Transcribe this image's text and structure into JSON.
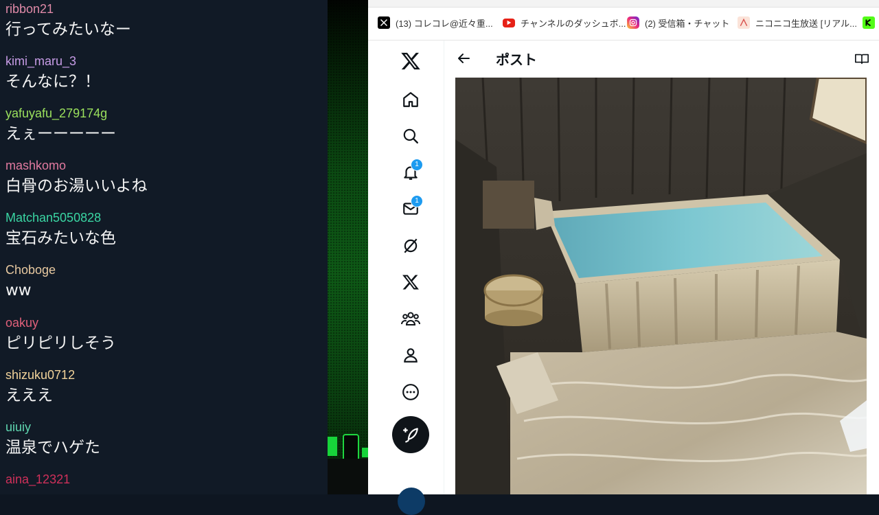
{
  "chat": {
    "messages": [
      {
        "user": "ribbon21",
        "text": "行ってみたいなー",
        "color": "#e08aa8"
      },
      {
        "user": "kimi_maru_3",
        "text": "そんなに？！",
        "color": "#c79ce6"
      },
      {
        "user": "yafuyafu_279174g",
        "text": "えぇーーーーー",
        "color": "#9be15d"
      },
      {
        "user": "mashkomo",
        "text": "白骨のお湯いいよね",
        "color": "#e27aa0"
      },
      {
        "user": "Matchan5050828",
        "text": "宝石みたいな色",
        "color": "#3ad6a3"
      },
      {
        "user": "Choboge",
        "text": "ww",
        "color": "#e8c9a0"
      },
      {
        "user": "oakuy",
        "text": "ピリピリしそう",
        "color": "#e0607a"
      },
      {
        "user": "shizuku0712",
        "text": "えええ",
        "color": "#f2d39a"
      },
      {
        "user": "uiuiy",
        "text": "温泉でハゲた",
        "color": "#5fd6b0"
      },
      {
        "user": "aina_12321",
        "text": "",
        "color": "#d0305a"
      }
    ]
  },
  "browser": {
    "tabs": [
      {
        "label": "(13) コレコレ@近々重...",
        "icon": "x-logo-icon"
      },
      {
        "label": "チャンネルのダッシュボ...",
        "icon": "youtube-icon"
      },
      {
        "label": "(2) 受信箱・チャット",
        "icon": "instagram-icon"
      },
      {
        "label": "ニコニコ生放送 [リアル...",
        "icon": "niconico-icon"
      }
    ],
    "nav": {
      "notifications_badge": "1",
      "messages_badge": "1",
      "items": [
        "x-logo-icon",
        "home-icon",
        "search-icon",
        "bell-icon",
        "mail-icon",
        "grok-icon",
        "x-premium-icon",
        "communities-icon",
        "profile-icon",
        "more-icon"
      ]
    },
    "post_header": {
      "title": "ポスト"
    }
  }
}
